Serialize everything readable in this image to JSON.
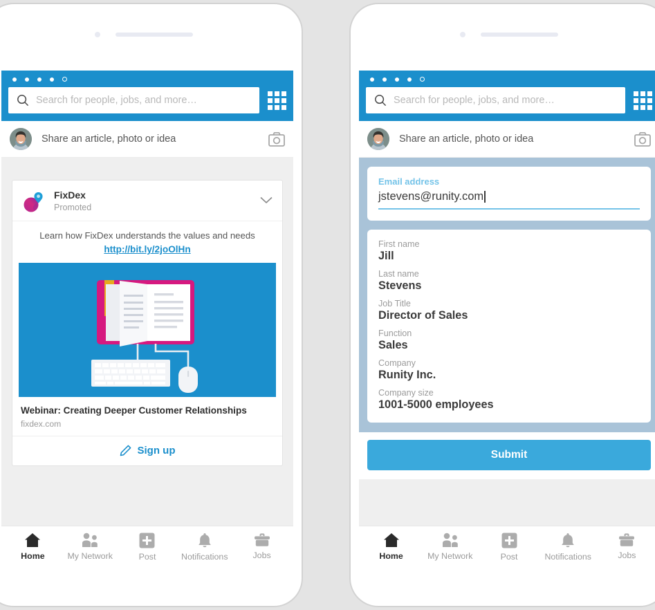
{
  "background_color": "#e4e4e4",
  "accent_blue": "#1b8fcc",
  "submit_blue": "#3aa9dc",
  "form_overlay_color": "#a9c3d8",
  "app": {
    "search": {
      "placeholder": "Search for people, jobs, and more…",
      "icon": "search-icon"
    },
    "grid_icon": "apps-grid-icon",
    "share": {
      "placeholder": "Share an article, photo or idea",
      "camera_icon": "camera-icon",
      "avatar": "user-avatar"
    },
    "status_dots": [
      "filled",
      "filled",
      "filled",
      "filled",
      "hollow"
    ]
  },
  "ad": {
    "advertiser": "FixDex",
    "promoted_label": "Promoted",
    "chevron_icon": "chevron-down-icon",
    "copy": "Learn how FixDex understands the values and needs",
    "link": "http://bit.ly/2joOlHn",
    "title": "Webinar: Creating Deeper Customer Relationships",
    "domain": "fixdex.com",
    "cta_label": "Sign up",
    "cta_icon": "pencil-icon",
    "image_alt": "open-book-keyboard-mouse-illustration"
  },
  "lead_form": {
    "active_field": {
      "label": "Email address",
      "value": "jstevens@runity.com"
    },
    "fields": [
      {
        "label": "First name",
        "value": "Jill"
      },
      {
        "label": "Last name",
        "value": "Stevens"
      },
      {
        "label": "Job Title",
        "value": "Director of Sales"
      },
      {
        "label": "Function",
        "value": "Sales"
      },
      {
        "label": "Company",
        "value": "Runity Inc."
      },
      {
        "label": "Company size",
        "value": "1001-5000 employees"
      }
    ],
    "submit_label": "Submit"
  },
  "nav": {
    "items": [
      {
        "label": "Home",
        "icon": "home-icon",
        "active": true
      },
      {
        "label": "My Network",
        "icon": "people-icon",
        "active": false
      },
      {
        "label": "Post",
        "icon": "plus-square-icon",
        "active": false
      },
      {
        "label": "Notifications",
        "icon": "bell-icon",
        "active": false
      },
      {
        "label": "Jobs",
        "icon": "briefcase-icon",
        "active": false
      }
    ]
  }
}
